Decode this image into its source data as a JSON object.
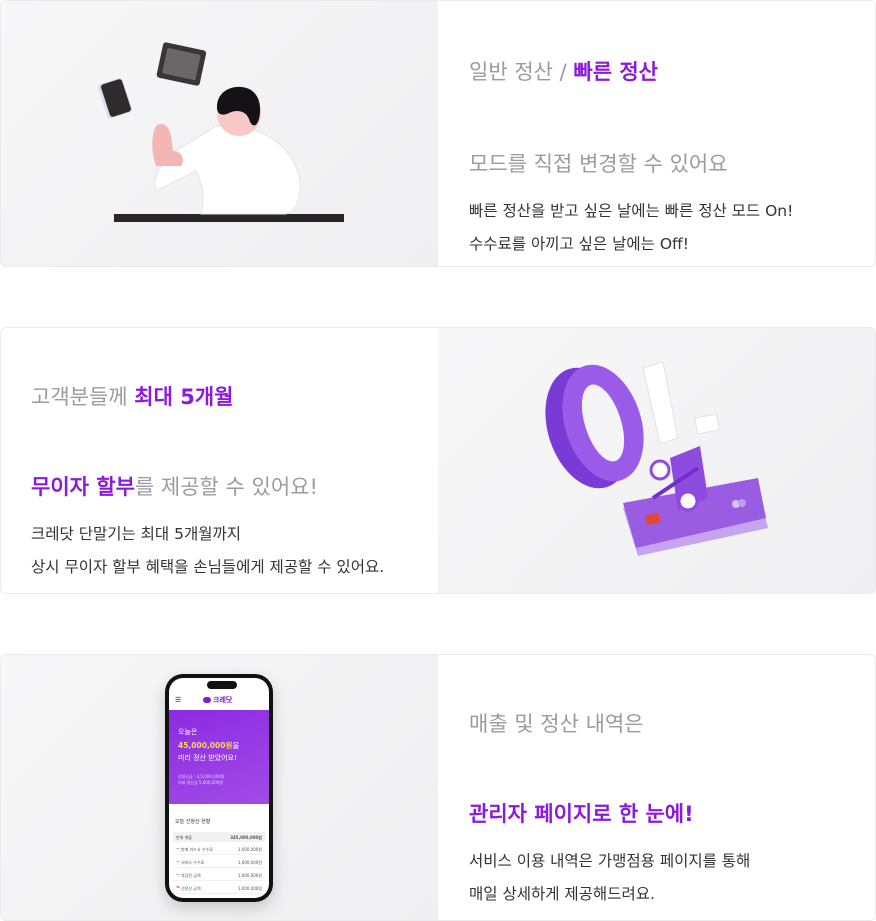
{
  "cards": [
    {
      "heading_line1_plain": "일반 정산 / ",
      "heading_line1_highlight": "빠른 정산",
      "heading_line2": "모드를 직접 변경할 수 있어요",
      "body_line1": "빠른 정산을 받고 싶은 날에는 빠른 정산 모드 On!",
      "body_line2": "수수료를 아끼고 싶은  날에는 Off!"
    },
    {
      "heading_line1_plain": "고객분들께 ",
      "heading_line1_highlight": "최대 5개월",
      "heading_line2_highlight": "무이자 할부",
      "heading_line2_plain": "를 제공할 수 있어요!",
      "body_line1": "크레닷 단말기는 최대 5개월까지",
      "body_line2": "상시 무이자 할부 혜택을 손님들에게 제공할 수 있어요.",
      "illustration_text": "0%"
    },
    {
      "heading_line1": "매출 및 정산 내역은",
      "heading_line2_highlight": "관리자 페이지로 한 눈에!",
      "body_line1": "서비스 이용 내역은 가맹점용 페이지를 통해",
      "body_line2": "매일 상세하게 제공해드려요."
    }
  ],
  "phone": {
    "brand": "크레닷",
    "hero_line1": "오늘은",
    "hero_amount": "45,000,000원",
    "hero_amount_suffix": "을",
    "hero_line3": "미리 정산 받았어요!",
    "hero_sub1": "선정산금 : 4,5,000,000원",
    "hero_sub2": "미래 정산금 5,000,000원",
    "list_title": "오늘 선정산 현황",
    "list_head_label": "판매 매출",
    "list_head_value": "345,000,000원",
    "rows": [
      {
        "label": "판매 카드사 수수료",
        "value": "1,000,000원"
      },
      {
        "label": "서비스 수수료",
        "value": "1,000,000원"
      },
      {
        "label": "차감된 금액",
        "value": "1,000,000원"
      },
      {
        "label": "선정산 금액",
        "value": "1,000,000원"
      }
    ]
  },
  "colors": {
    "accent": "#8a1bdc",
    "muted_heading": "#9a9aa3",
    "body": "#333338"
  }
}
